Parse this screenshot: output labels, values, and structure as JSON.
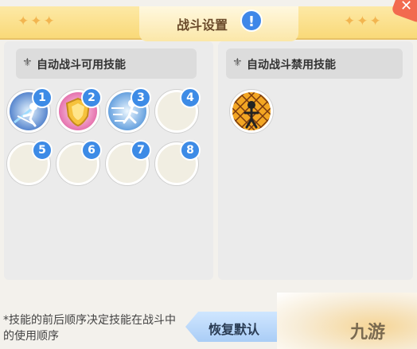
{
  "header": {
    "title": "战斗设置",
    "info_icon": "!",
    "stars_left": "✦✦✦",
    "stars_right": "✦✦✦"
  },
  "available_panel": {
    "title": "自动战斗可用技能",
    "slots": [
      {
        "number": "1",
        "icon": "skill-ice-strike-icon",
        "filled": true
      },
      {
        "number": "2",
        "icon": "skill-shield-icon",
        "filled": true
      },
      {
        "number": "3",
        "icon": "skill-dash-icon",
        "filled": true
      },
      {
        "number": "4",
        "filled": false
      },
      {
        "number": "5",
        "filled": false
      },
      {
        "number": "6",
        "filled": false
      },
      {
        "number": "7",
        "filled": false
      },
      {
        "number": "8",
        "filled": false
      }
    ]
  },
  "disabled_panel": {
    "title": "自动战斗禁用技能",
    "slots": [
      {
        "icon": "skill-net-trap-icon",
        "filled": true
      }
    ]
  },
  "footer": {
    "note": "*技能的前后顺序决定技能在战斗中的使用顺序",
    "reset_label": "恢复默认",
    "watermark": "九游"
  },
  "colors": {
    "accent_blue": "#3d8be6",
    "banner_yellow": "#f9d978",
    "close_red": "#f26a4f"
  }
}
